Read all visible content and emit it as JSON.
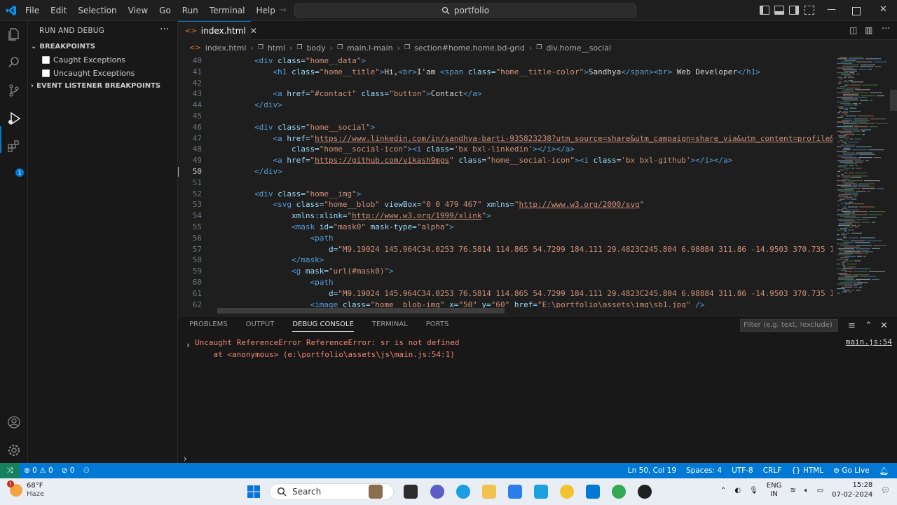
{
  "menu": [
    "File",
    "Edit",
    "Selection",
    "View",
    "Go",
    "Run",
    "Terminal",
    "Help"
  ],
  "command_center": "portfolio",
  "sidebar": {
    "title": "RUN AND DEBUG",
    "sections": {
      "breakpoints": "BREAKPOINTS",
      "caught": "Caught Exceptions",
      "uncaught": "Uncaught Exceptions",
      "event_listener": "EVENT LISTENER BREAKPOINTS"
    }
  },
  "activity_badge": "1",
  "tab": {
    "label": "index.html"
  },
  "breadcrumb": [
    "index.html",
    "html",
    "body",
    "main.l-main",
    "section#home.home.bd-grid",
    "div.home__social"
  ],
  "code_lines": [
    {
      "n": "40",
      "indent": 8,
      "tokens": [
        [
          "t",
          "<div "
        ],
        [
          "a",
          "class="
        ],
        [
          "s",
          "\"home__data\""
        ],
        [
          "t",
          ">"
        ]
      ]
    },
    {
      "n": "41",
      "indent": 12,
      "tokens": [
        [
          "t",
          "<h1 "
        ],
        [
          "a",
          "class="
        ],
        [
          "s",
          "\"home__title\""
        ],
        [
          "t",
          ">"
        ],
        [
          "x",
          "Hi,"
        ],
        [
          "t",
          "<br>"
        ],
        [
          "x",
          "I'am "
        ],
        [
          "t",
          "<span "
        ],
        [
          "a",
          "class="
        ],
        [
          "s",
          "\"home__title-color\""
        ],
        [
          "t",
          ">"
        ],
        [
          "x",
          "Sandhya"
        ],
        [
          "t",
          "</span><br>"
        ],
        [
          "x",
          " Web Developer"
        ],
        [
          "t",
          "</h1>"
        ]
      ]
    },
    {
      "n": "42",
      "indent": 0,
      "tokens": []
    },
    {
      "n": "43",
      "indent": 12,
      "tokens": [
        [
          "t",
          "<a "
        ],
        [
          "a",
          "href="
        ],
        [
          "s",
          "\"#contact\""
        ],
        [
          "x",
          " "
        ],
        [
          "a",
          "class="
        ],
        [
          "s",
          "\"button\""
        ],
        [
          "t",
          ">"
        ],
        [
          "x",
          "Contact"
        ],
        [
          "t",
          "</a>"
        ]
      ]
    },
    {
      "n": "44",
      "indent": 8,
      "tokens": [
        [
          "t",
          "</div>"
        ]
      ]
    },
    {
      "n": "45",
      "indent": 0,
      "tokens": []
    },
    {
      "n": "46",
      "indent": 8,
      "tokens": [
        [
          "t",
          "<div "
        ],
        [
          "a",
          "class="
        ],
        [
          "s",
          "\"home__social\""
        ],
        [
          "t",
          ">"
        ]
      ]
    },
    {
      "n": "47",
      "indent": 12,
      "tokens": [
        [
          "t",
          "<a "
        ],
        [
          "a",
          "href="
        ],
        [
          "s",
          "\""
        ],
        [
          "l",
          "https://www.linkedin.com/in/sandhya-barti-935823238?utm_source=share&utm_campaign=share_via&utm_content=profile&"
        ]
      ]
    },
    {
      "n": "48",
      "indent": 16,
      "tokens": [
        [
          "a",
          "class="
        ],
        [
          "s",
          "\"home__social-icon\""
        ],
        [
          "t",
          ">"
        ],
        [
          "t",
          "<i "
        ],
        [
          "a",
          "class="
        ],
        [
          "s",
          "'bx bxl-linkedin'"
        ],
        [
          "t",
          "></i></a>"
        ]
      ]
    },
    {
      "n": "49",
      "indent": 12,
      "tokens": [
        [
          "t",
          "<a "
        ],
        [
          "a",
          "href="
        ],
        [
          "s",
          "\""
        ],
        [
          "l",
          "https://github.com/vikash9mgs"
        ],
        [
          "s",
          "\""
        ],
        [
          "x",
          " "
        ],
        [
          "a",
          "class="
        ],
        [
          "s",
          "\"home__social-icon\""
        ],
        [
          "t",
          "><i "
        ],
        [
          "a",
          "class="
        ],
        [
          "s",
          "'bx bxl-github'"
        ],
        [
          "t",
          "></i></a>"
        ]
      ]
    },
    {
      "n": "50",
      "indent": 8,
      "tokens": [
        [
          "t",
          "</div>"
        ]
      ],
      "current": true
    },
    {
      "n": "51",
      "indent": 0,
      "tokens": []
    },
    {
      "n": "52",
      "indent": 8,
      "tokens": [
        [
          "t",
          "<div "
        ],
        [
          "a",
          "class="
        ],
        [
          "s",
          "\"home__img\""
        ],
        [
          "t",
          ">"
        ]
      ]
    },
    {
      "n": "53",
      "indent": 12,
      "tokens": [
        [
          "t",
          "<svg "
        ],
        [
          "a",
          "class="
        ],
        [
          "s",
          "\"home__blob\""
        ],
        [
          "x",
          " "
        ],
        [
          "a",
          "viewBox="
        ],
        [
          "s",
          "\"0 0 479 467\""
        ],
        [
          "x",
          " "
        ],
        [
          "a",
          "xmlns="
        ],
        [
          "s",
          "\""
        ],
        [
          "l",
          "http://www.w3.org/2000/svg"
        ],
        [
          "s",
          "\""
        ]
      ]
    },
    {
      "n": "54",
      "indent": 16,
      "tokens": [
        [
          "a",
          "xmlns:xlink="
        ],
        [
          "s",
          "\""
        ],
        [
          "l",
          "http://www.w3.org/1999/xlink"
        ],
        [
          "s",
          "\""
        ],
        [
          "t",
          ">"
        ]
      ]
    },
    {
      "n": "55",
      "indent": 16,
      "tokens": [
        [
          "t",
          "<mask "
        ],
        [
          "a",
          "id="
        ],
        [
          "s",
          "\"mask0\""
        ],
        [
          "x",
          " "
        ],
        [
          "a",
          "mask-type="
        ],
        [
          "s",
          "\"alpha\""
        ],
        [
          "t",
          ">"
        ]
      ]
    },
    {
      "n": "56",
      "indent": 20,
      "tokens": [
        [
          "t",
          "<path"
        ]
      ]
    },
    {
      "n": "57",
      "indent": 24,
      "tokens": [
        [
          "a",
          "d="
        ],
        [
          "s",
          "\"M9.19024 145.964C34.0253 76.5814 114.865 54.7299 184.111 29.4823C245.804 6.98884 311.86 -14.9503 370.735 1"
        ]
      ]
    },
    {
      "n": "58",
      "indent": 16,
      "tokens": [
        [
          "t",
          "</mask>"
        ]
      ]
    },
    {
      "n": "59",
      "indent": 16,
      "tokens": [
        [
          "t",
          "<g "
        ],
        [
          "a",
          "mask="
        ],
        [
          "s",
          "\"url(#mask0)\""
        ],
        [
          "t",
          ">"
        ]
      ]
    },
    {
      "n": "60",
      "indent": 20,
      "tokens": [
        [
          "t",
          "<path"
        ]
      ]
    },
    {
      "n": "61",
      "indent": 24,
      "tokens": [
        [
          "a",
          "d="
        ],
        [
          "s",
          "\"M9.19024 145.964C34.0253 76.5814 114.865 54.7299 184.111 29.4823C245.804 6.98884 311.86 -14.9503 370.735 1"
        ]
      ]
    },
    {
      "n": "62",
      "indent": 20,
      "tokens": [
        [
          "t",
          "<image "
        ],
        [
          "a",
          "class="
        ],
        [
          "s",
          "\"home__blob-img\""
        ],
        [
          "x",
          " "
        ],
        [
          "a",
          "x="
        ],
        [
          "s",
          "\"50\""
        ],
        [
          "x",
          " "
        ],
        [
          "a",
          "y="
        ],
        [
          "s",
          "\"60\""
        ],
        [
          "x",
          " "
        ],
        [
          "a",
          "href="
        ],
        [
          "s",
          "\"E:\\portfolio\\assets\\img\\sb1.jpg\""
        ],
        [
          "x",
          " "
        ],
        [
          "t",
          "/>"
        ]
      ]
    }
  ],
  "panel": {
    "tabs": [
      "PROBLEMS",
      "OUTPUT",
      "DEBUG CONSOLE",
      "TERMINAL",
      "PORTS"
    ],
    "active_tab": "DEBUG CONSOLE",
    "filter_placeholder": "Filter (e.g. text, !exclude)",
    "error_line1": "Uncaught ReferenceError ReferenceError: sr is not defined",
    "error_line2": "    at <anonymous> (e:\\portfolio\\assets\\js\\main.js:54:1)",
    "error_source": "main.js:54"
  },
  "statusbar": {
    "errors": "0",
    "warnings": "0",
    "ports": "0",
    "position": "Ln 50, Col 19",
    "spaces": "Spaces: 4",
    "encoding": "UTF-8",
    "eol": "CRLF",
    "language": "HTML",
    "golive": "Go Live"
  },
  "taskbar": {
    "weather_temp": "68°F",
    "weather_desc": "Haze",
    "weather_badge": "1",
    "search": "Search",
    "lang1": "ENG",
    "lang2": "IN",
    "time": "15:28",
    "date": "07-02-2024"
  },
  "colors": {
    "accent": "#0078d4",
    "remote": "#16825d",
    "error": "#f48771"
  }
}
